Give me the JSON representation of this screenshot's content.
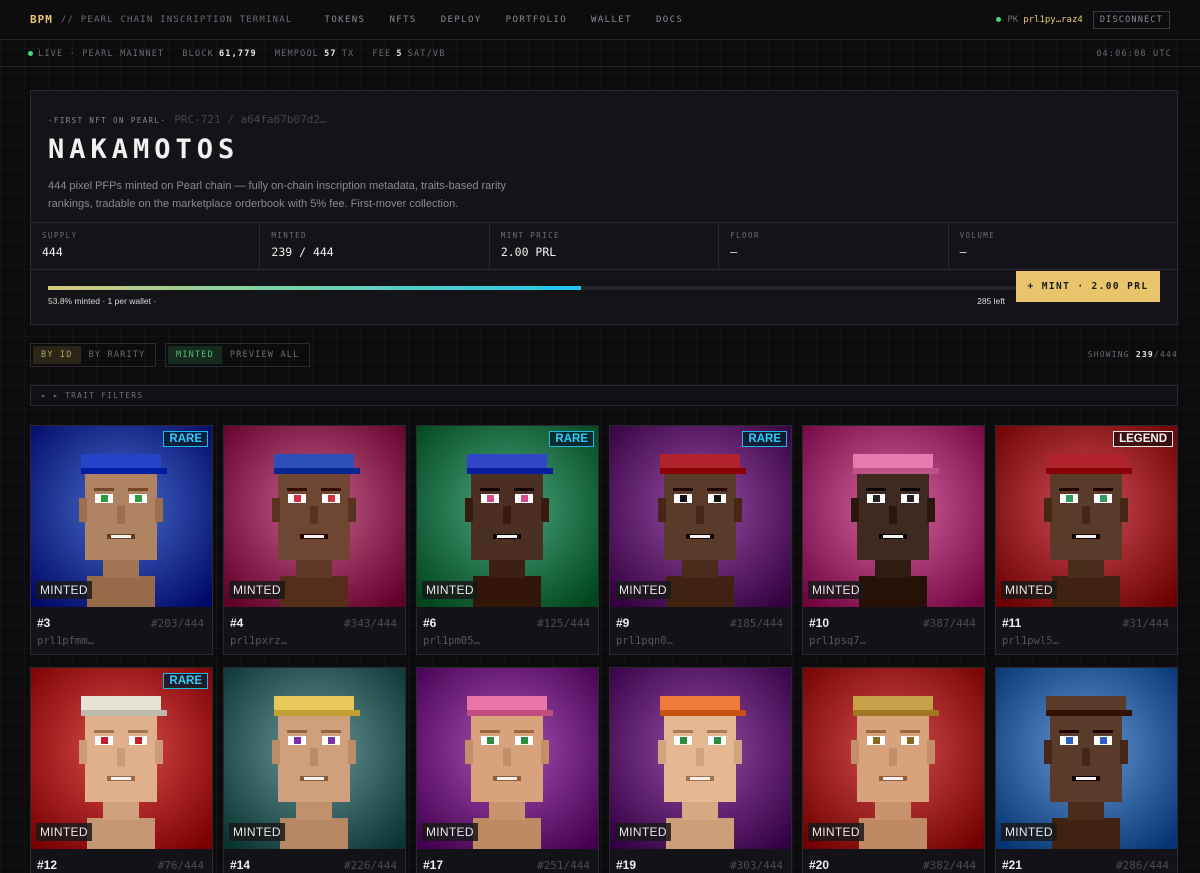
{
  "nav": {
    "brand": "BPM",
    "subtitle": "// PEARL CHAIN INSCRIPTION TERMINAL",
    "links": [
      "TOKENS",
      "NFTS",
      "DEPLOY",
      "PORTFOLIO",
      "WALLET",
      "DOCS"
    ],
    "pk_label": "PK",
    "pk_addr": "prl1py…raz4",
    "disconnect": "DISCONNECT"
  },
  "status": {
    "live": "LIVE · PEARL MAINNET",
    "block_label": "BLOCK",
    "block_val": "61,779",
    "mempool_label": "MEMPOOL",
    "mempool_val": "57",
    "mempool_unit": "TX",
    "fee_label": "FEE",
    "fee_val": "5",
    "fee_unit": "SAT/VB",
    "time": "04:06:08 UTC"
  },
  "hero": {
    "eyebrow": "·FIRST NFT ON PEARL·",
    "prc": "PRC-721 / a64fa67b07d2…",
    "title": "NAKAMOTOS",
    "description": "444 pixel PFPs minted on Pearl chain — fully on-chain inscription metadata, traits-based rarity rankings, tradable on the marketplace orderbook with 5% fee. First-mover collection.",
    "stats": [
      {
        "label": "SUPPLY",
        "value": "444"
      },
      {
        "label": "MINTED",
        "value": "239 / 444"
      },
      {
        "label": "MINT PRICE",
        "value": "2.00 PRL"
      },
      {
        "label": "FLOOR",
        "value": "—"
      },
      {
        "label": "VOLUME",
        "value": "—"
      }
    ],
    "progress_fraction": 0.538,
    "progress_text": "53.8% minted · 1 per wallet ·",
    "left_text": "285 left",
    "mint_button": "+ MINT · 2.00 PRL"
  },
  "toolbar": {
    "sort_id": "BY ID",
    "sort_rarity": "BY RARITY",
    "minted": "MINTED",
    "preview": "PREVIEW ALL",
    "showing_label": "SHOWING",
    "showing_count": "239",
    "showing_total": "/444",
    "filters": "▸ ▸ TRAIT FILTERS"
  },
  "cards": [
    {
      "id": "#3",
      "rank": "#203/444",
      "owner": "prl1pfmm…",
      "badge": "RARE",
      "status": "MINTED",
      "bg": "#2a4fae",
      "skin": "#b08462",
      "hat": "#2545c9",
      "eye": "#2e9a3c"
    },
    {
      "id": "#4",
      "rank": "#343/444",
      "owner": "prl1pxrz…",
      "badge": "",
      "status": "MINTED",
      "bg": "#a8436f",
      "skin": "#6e4631",
      "hat": "#2d4db8",
      "eye": "#d03040"
    },
    {
      "id": "#6",
      "rank": "#125/444",
      "owner": "prl1pm05…",
      "badge": "RARE",
      "status": "MINTED",
      "bg": "#2d8a62",
      "skin": "#4a2f22",
      "hat": "#3244c8",
      "eye": "#d44a86"
    },
    {
      "id": "#9",
      "rank": "#185/444",
      "owner": "prl1pqn0…",
      "badge": "RARE",
      "status": "MINTED",
      "bg": "#7a2f86",
      "skin": "#5a3a28",
      "hat": "#b0222c",
      "eye": "#111111"
    },
    {
      "id": "#10",
      "rank": "#387/444",
      "owner": "prl1psq7…",
      "badge": "",
      "status": "MINTED",
      "bg": "#b84a86",
      "skin": "#3e2a20",
      "hat": "#e87ab0",
      "eye": "#222222"
    },
    {
      "id": "#11",
      "rank": "#31/444",
      "owner": "prl1pwl5…",
      "badge": "LEGEND",
      "status": "MINTED",
      "bg": "#b2303a",
      "skin": "#5a3a28",
      "hat": "#b0222c",
      "eye": "#2e9a5c"
    },
    {
      "id": "#12",
      "rank": "#76/444",
      "owner": "",
      "badge": "RARE",
      "status": "MINTED",
      "bg": "#c02f2f",
      "skin": "#e0b08c",
      "hat": "#e6e2d6",
      "eye": "#c0202c"
    },
    {
      "id": "#14",
      "rank": "#226/444",
      "owner": "",
      "badge": "",
      "status": "MINTED",
      "bg": "#4f7a7a",
      "skin": "#d0a07c",
      "hat": "#e8c85a",
      "eye": "#7a30b0"
    },
    {
      "id": "#17",
      "rank": "#251/444",
      "owner": "",
      "badge": "",
      "status": "MINTED",
      "bg": "#8a3596",
      "skin": "#d8a27c",
      "hat": "#e877a8",
      "eye": "#2e8a3c"
    },
    {
      "id": "#19",
      "rank": "#303/444",
      "owner": "",
      "badge": "",
      "status": "MINTED",
      "bg": "#7a2f8a",
      "skin": "#e6b892",
      "hat": "#f07a3a",
      "eye": "#2e8a3c"
    },
    {
      "id": "#20",
      "rank": "#382/444",
      "owner": "",
      "badge": "",
      "status": "MINTED",
      "bg": "#b83030",
      "skin": "#d8a27c",
      "hat": "#c8a04a",
      "eye": "#8a6a20"
    },
    {
      "id": "#21",
      "rank": "#286/444",
      "owner": "",
      "badge": "",
      "status": "MINTED",
      "bg": "#4a7ab8",
      "skin": "#5a3a28",
      "hat": "#5a3a28",
      "eye": "#2a60c8"
    }
  ]
}
